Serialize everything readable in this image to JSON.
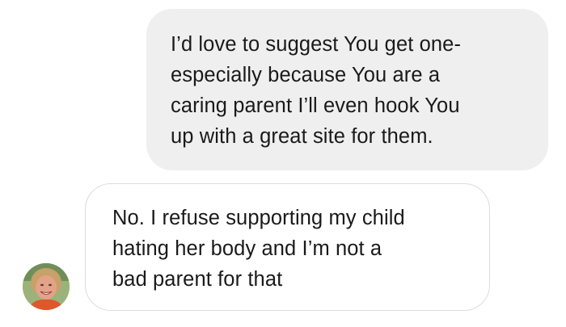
{
  "conversation": {
    "messages": [
      {
        "direction": "outgoing",
        "text": "I’d love to suggest You get one-\nespecially because You are a\ncaring parent I’ll even hook You\nup with a great site for them."
      },
      {
        "direction": "incoming",
        "text": "No. I refuse supporting my child\nhating her body and I’m not a\nbad parent for that"
      }
    ],
    "contact": {
      "avatar_icon": "profile-photo-avatar"
    }
  },
  "colors": {
    "outgoing_bubble": "#efefef",
    "incoming_border": "#dcdcdc",
    "text": "#1a1a1a",
    "background": "#ffffff"
  }
}
